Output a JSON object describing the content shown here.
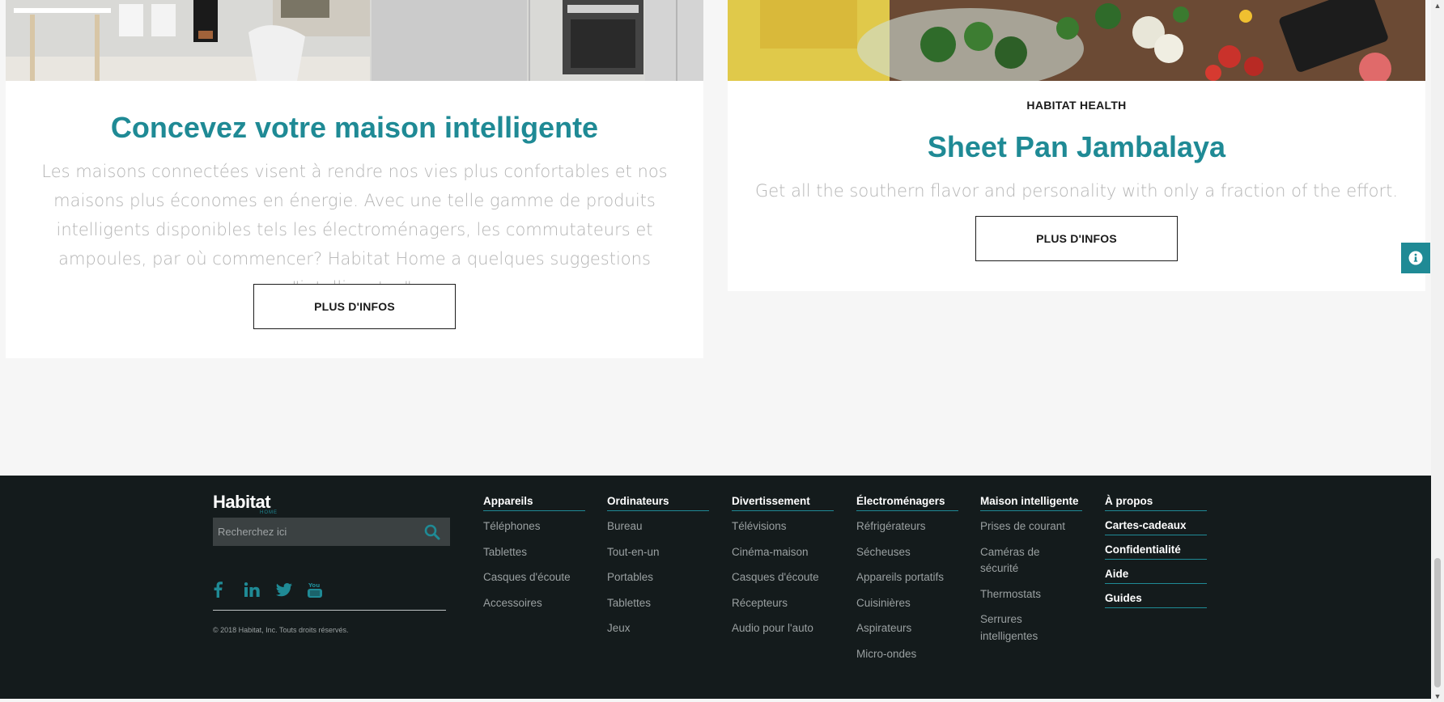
{
  "cards": [
    {
      "title": "Concevez votre maison intelligente",
      "description": "Les maisons connectées visent à rendre nos vies plus confortables et nos maisons plus économes en énergie. Avec une telle gamme de produits intelligents disponibles tels les électroménagers, les commutateurs et ampoules, par où commencer? Habitat Home a quelques suggestions \"intelligentes\".",
      "button_label": "PLUS D'INFOS"
    },
    {
      "eyebrow": "HABITAT HEALTH",
      "title": "Sheet Pan Jambalaya",
      "description": "Get all the southern flavor and personality with only a fraction of the effort.",
      "button_label": "PLUS D'INFOS"
    }
  ],
  "info_tab": {
    "icon": "info-icon"
  },
  "footer": {
    "logo": "Habitat",
    "logo_sub": "HOME",
    "search": {
      "placeholder": "Recherchez ici",
      "value": "",
      "icon": "search-icon"
    },
    "socials": [
      "facebook-icon",
      "linkedin-icon",
      "twitter-icon",
      "youtube-icon"
    ],
    "copyright": "© 2018 Habitat, Inc. Touts droits réservés.",
    "columns": [
      {
        "title": "Appareils",
        "items": [
          "Téléphones",
          "Tablettes",
          "Casques d'écoute",
          "Accessoires"
        ]
      },
      {
        "title": "Ordinateurs",
        "items": [
          "Bureau",
          "Tout-en-un",
          "Portables",
          "Tablettes",
          "Jeux"
        ]
      },
      {
        "title": "Divertissement",
        "items": [
          "Télévisions",
          "Cinéma-maison",
          "Casques d'écoute",
          "Récepteurs",
          "Audio pour l'auto"
        ]
      },
      {
        "title": "Électroménagers",
        "items": [
          "Réfrigérateurs",
          "Sécheuses",
          "Appareils portatifs",
          "Cuisinières",
          "Aspirateurs",
          "Micro-ondes"
        ]
      },
      {
        "title": "Maison intelligente",
        "items": [
          "Prises de courant",
          "Caméras de sécurité",
          "Thermostats",
          "Serrures intelligentes"
        ]
      }
    ],
    "about": [
      "À propos",
      "Cartes-cadeaux",
      "Confidentialité",
      "Aide",
      "Guides"
    ]
  },
  "colors": {
    "accent": "#1f8a95",
    "footer_bg": "#141b1c",
    "page_bg": "#f6f6f6"
  }
}
